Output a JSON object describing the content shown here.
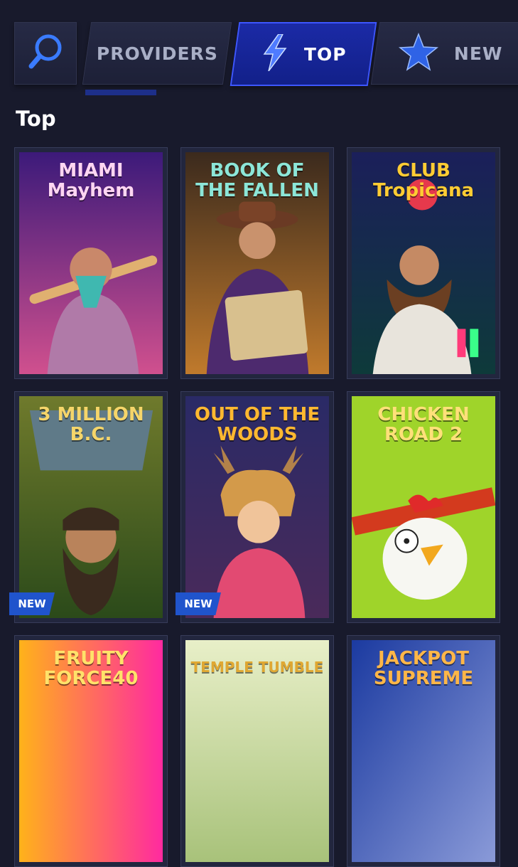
{
  "tabs": {
    "providers_label": "PROVIDERS",
    "top_label": "TOP",
    "new_label": "NEW",
    "active": "TOP"
  },
  "section": {
    "title": "Top"
  },
  "games": [
    {
      "title": "MIAMI\nMayhem",
      "badge": ""
    },
    {
      "title": "BOOK OF\nTHE FALLEN",
      "badge": ""
    },
    {
      "title": "CLUB\nTropicana",
      "badge": ""
    },
    {
      "title": "3 MILLION\nB.C.",
      "badge": "NEW"
    },
    {
      "title": "OUT OF THE\nWOODS",
      "badge": "NEW"
    },
    {
      "title": "CHICKEN\nROAD 2",
      "badge": ""
    },
    {
      "title": "FRUITY\nFORCE40",
      "badge": ""
    },
    {
      "title": "TEMPLE TUMBLE",
      "badge": ""
    },
    {
      "title": "JACKPOT\nSUPREME",
      "badge": ""
    }
  ],
  "colors": {
    "background": "#181a2c",
    "active_tab": "#1b2aa6",
    "badge": "#2054cc"
  }
}
